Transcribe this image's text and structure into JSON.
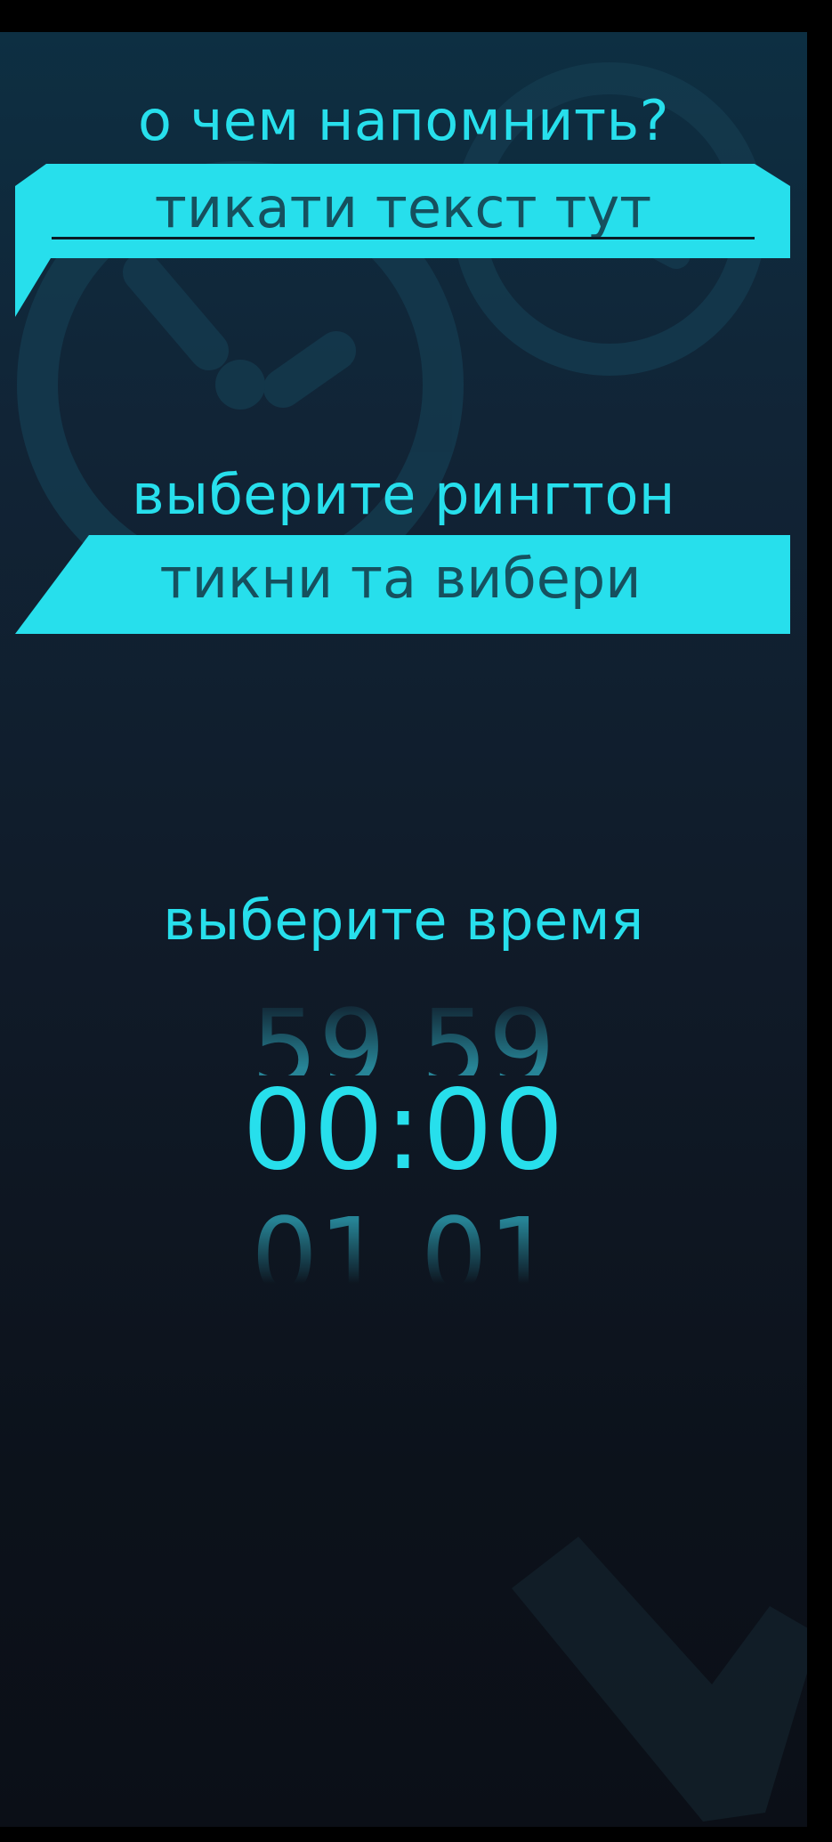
{
  "reminder": {
    "title": "о чем напомнить?",
    "input_value": "тикати текст тут"
  },
  "ringtone": {
    "title": "выберите рингтон",
    "button_label": "тикни та вибери"
  },
  "time": {
    "title": "выберите время",
    "previous": "59 59",
    "current": "00:00",
    "next": "01 01"
  },
  "colors": {
    "accent": "#27dfec",
    "accent_text_dark": "#16505e",
    "background_top": "#0d2f42",
    "background_bottom": "#0b0f17",
    "frame": "#000000",
    "decor": "#15374b"
  },
  "icons": {
    "background_clock": "clock-icon",
    "background_check": "checkmark-icon"
  }
}
